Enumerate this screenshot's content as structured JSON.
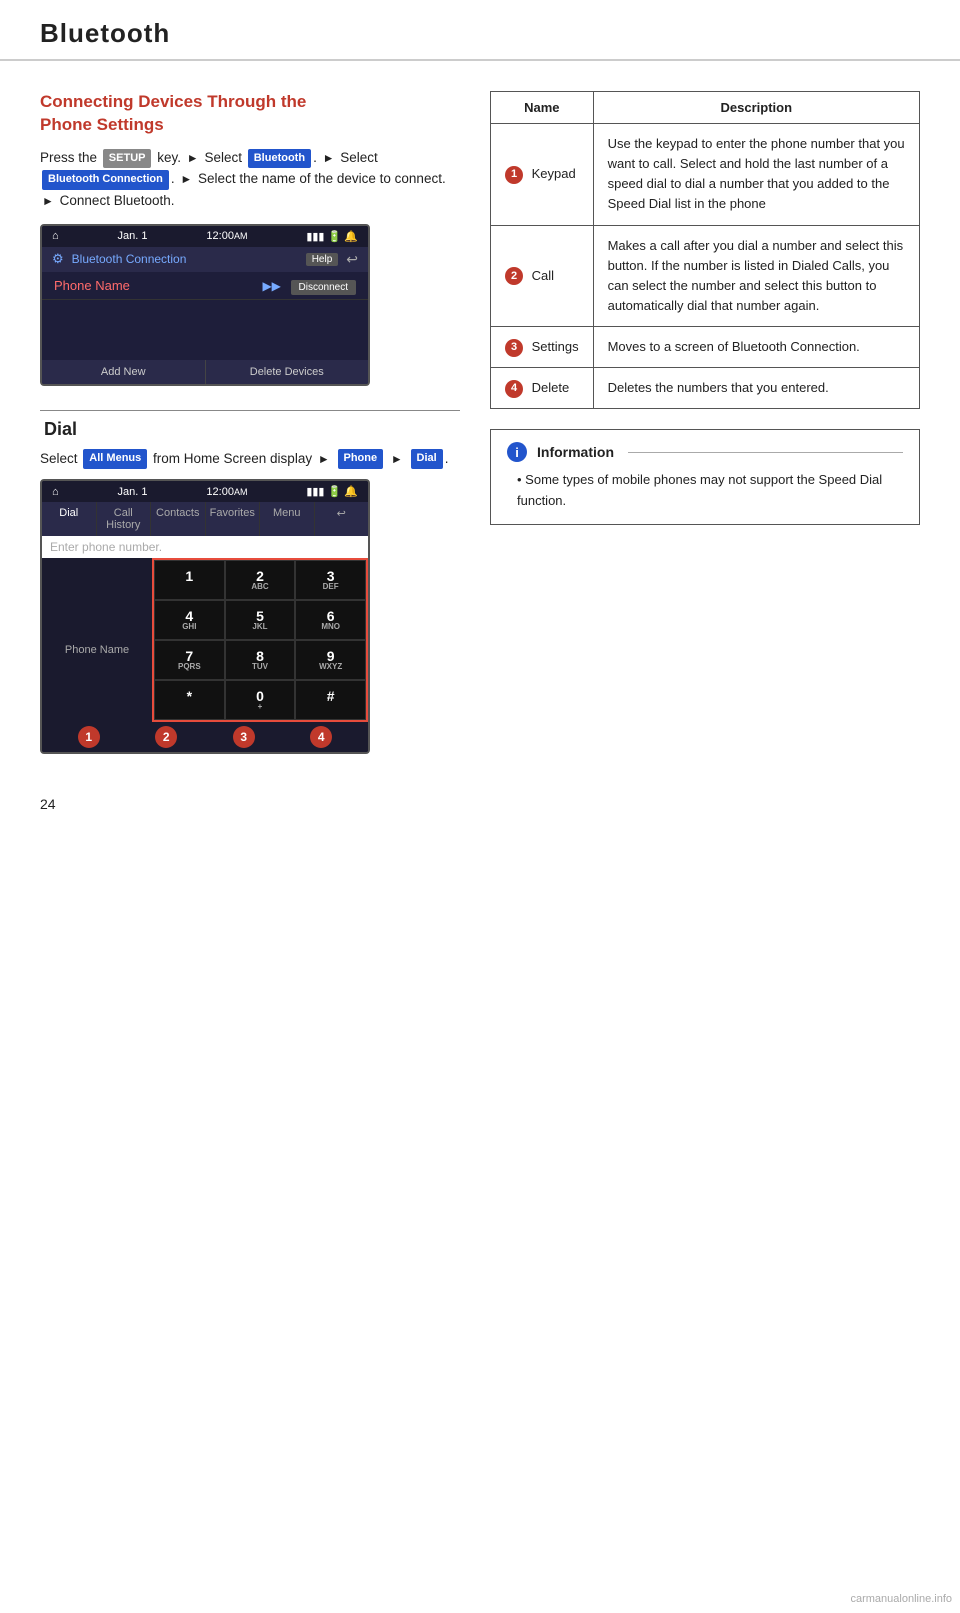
{
  "header": {
    "title": "Bluetooth"
  },
  "left": {
    "section1": {
      "title_line1": "Connecting Devices Through the",
      "title_line2": "Phone Settings",
      "text1": "Press the",
      "setup_key": "SETUP",
      "text2": "key.",
      "text3": "Select",
      "bluetooth_badge": "Bluetooth",
      "text4": "Select",
      "bt_conn_badge": "Bluetooth Connection",
      "text5": "Select the name of the device to connect.",
      "text6": "Connect Bluetooth."
    },
    "screen1": {
      "date": "Jan.  1",
      "time": "12:00",
      "am": "AM",
      "nav_title": "Bluetooth Connection",
      "help": "Help",
      "phone_name": "Phone Name",
      "disconnect": "Disconnect",
      "btn1": "Add New",
      "btn2": "Delete Devices"
    },
    "dial_section": {
      "title": "Dial",
      "text1": "Select",
      "all_menus_badge": "All Menus",
      "text2": "from Home Screen display",
      "phone_badge": "Phone",
      "dial_badge": "Dial"
    },
    "screen2": {
      "date": "Jan.  1",
      "time": "12:00",
      "am": "AM",
      "tab1": "Dial",
      "tab2": "Call History",
      "tab3": "Contacts",
      "tab4": "Favorites",
      "tab5": "Menu",
      "input_placeholder": "Enter phone number.",
      "phone_name": "Phone Name",
      "keys": [
        {
          "main": "1",
          "sub": ""
        },
        {
          "main": "2",
          "sub": "ABC"
        },
        {
          "main": "3",
          "sub": "DEF"
        },
        {
          "main": "4",
          "sub": "GHI"
        },
        {
          "main": "5",
          "sub": "JKL"
        },
        {
          "main": "6",
          "sub": "MNO"
        },
        {
          "main": "7",
          "sub": "PQRS"
        },
        {
          "main": "8",
          "sub": "TUV"
        },
        {
          "main": "9",
          "sub": "WXYZ"
        },
        {
          "main": "*",
          "sub": ""
        },
        {
          "main": "0",
          "sub": "+"
        },
        {
          "main": "#",
          "sub": ""
        }
      ],
      "badge1": "1",
      "badge2": "2",
      "badge3": "3",
      "badge4": "4"
    }
  },
  "right": {
    "table": {
      "col1": "Name",
      "col2": "Description",
      "rows": [
        {
          "num": "1",
          "name": "Keypad",
          "desc": "Use the keypad to enter the phone number that you want to call. Select and hold the last number of a speed dial to dial a number that you added to the Speed Dial list in the phone"
        },
        {
          "num": "2",
          "name": "Call",
          "desc": "Makes a call after you dial a number and select this button. If the number is listed in Dialed Calls, you can select the number and select this button to automatically dial that number again."
        },
        {
          "num": "3",
          "name": "Settings",
          "desc": "Moves to a screen of Bluetooth Connection."
        },
        {
          "num": "4",
          "name": "Delete",
          "desc": "Deletes the numbers that you entered."
        }
      ]
    },
    "info_box": {
      "title": "Information",
      "items": [
        "Some types of mobile phones may not support the Speed Dial function."
      ]
    }
  },
  "page_number": "24",
  "watermark": "carmanualonline.info"
}
